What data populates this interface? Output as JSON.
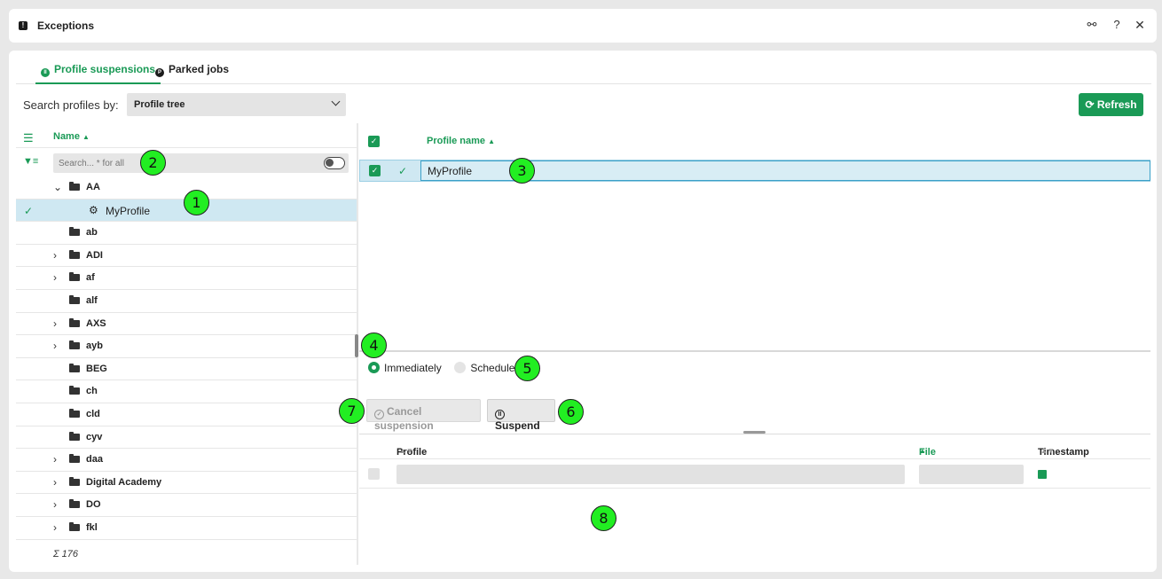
{
  "window": {
    "title": "Exceptions",
    "share_icon": "share-icon",
    "help_glyph": "?",
    "close_glyph": "✕"
  },
  "tabs": [
    {
      "label": "Profile suspensions",
      "icon_letter": "II",
      "active": true
    },
    {
      "label": "Parked jobs",
      "icon_letter": "P",
      "active": false
    }
  ],
  "search_by": {
    "label": "Search profiles by:",
    "selected": "Profile tree"
  },
  "refresh_label": "Refresh",
  "tree": {
    "name_header": "Name",
    "search_placeholder": "Search... * for all",
    "items": [
      {
        "label": "AA",
        "expanded": true
      },
      {
        "label": "MyProfile",
        "selected": true
      },
      {
        "label": "ab"
      },
      {
        "label": "ADI",
        "expandable": true
      },
      {
        "label": "af",
        "expandable": true
      },
      {
        "label": "alf"
      },
      {
        "label": "AXS",
        "expandable": true
      },
      {
        "label": "ayb",
        "expandable": true
      },
      {
        "label": "BEG"
      },
      {
        "label": "ch"
      },
      {
        "label": "cld"
      },
      {
        "label": "cyv"
      },
      {
        "label": "daa",
        "expandable": true
      },
      {
        "label": "Digital Academy",
        "expandable": true
      },
      {
        "label": "DO",
        "expandable": true
      },
      {
        "label": "fkl",
        "expandable": true
      }
    ],
    "sum": "Σ 176"
  },
  "selected_profiles": {
    "header": "Profile name",
    "rows": [
      {
        "name": "MyProfile"
      }
    ]
  },
  "timing": {
    "immediately": "Immediately",
    "scheduled": "Scheduled",
    "selected": "Immediately"
  },
  "actions": {
    "cancel": "Cancel suspension",
    "suspend": "Suspend"
  },
  "bottom_table": {
    "columns": [
      "Profile",
      "File",
      "Timestamp"
    ]
  },
  "markers": [
    "1",
    "2",
    "3",
    "4",
    "5",
    "6",
    "7",
    "8"
  ],
  "colors": {
    "accent": "#1a9a56",
    "selection": "#cfe8f2",
    "marker": "#22ee22"
  }
}
